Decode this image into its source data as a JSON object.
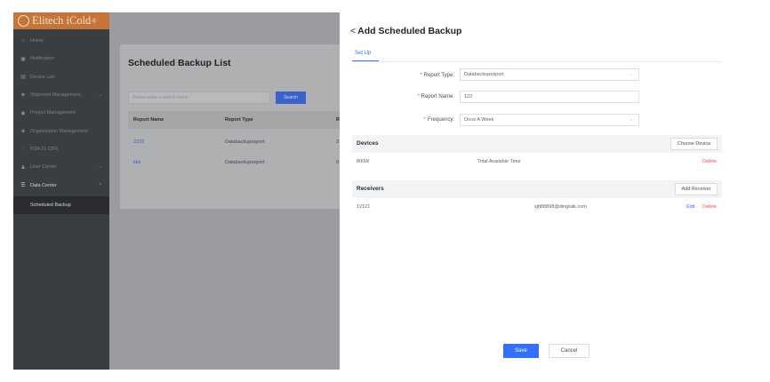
{
  "brand": {
    "name": "Elitech iCold",
    "mark": "®"
  },
  "sidebar": {
    "items": [
      {
        "label": "Home",
        "icon": "home-icon",
        "glyph": "⌂"
      },
      {
        "label": "Notification",
        "icon": "notification-icon",
        "glyph": "▣"
      },
      {
        "label": "Device List",
        "icon": "device-icon",
        "glyph": "▤"
      },
      {
        "label": "Shipment Management",
        "icon": "shipment-icon",
        "glyph": "⚑",
        "chevron": "⌄"
      },
      {
        "label": "Project Management",
        "icon": "project-icon",
        "glyph": "◉"
      },
      {
        "label": "Organization Management",
        "icon": "organization-icon",
        "glyph": "◈"
      },
      {
        "label": "FDA 21 CFR",
        "icon": "fda-icon",
        "glyph": "◌"
      },
      {
        "label": "User Center",
        "icon": "user-icon",
        "glyph": "♟",
        "chevron": "⌄"
      },
      {
        "label": "Data Center",
        "icon": "data-center-icon",
        "glyph": "☰",
        "chevron": "⌃"
      }
    ],
    "sub_item": "Scheduled Backup"
  },
  "list": {
    "title": "Scheduled Backup List",
    "search_placeholder": "Please enter a search name",
    "search_button": "Search",
    "columns": [
      "Report Name",
      "Report Type",
      "R"
    ],
    "rows": [
      {
        "name": "2222",
        "type": "Databackupexport",
        "extra": "3"
      },
      {
        "name": "kkk",
        "type": "Databackupexport",
        "extra": "0"
      }
    ]
  },
  "drawer": {
    "back": "<",
    "title": "Add Scheduled Backup",
    "tab": "Set Up",
    "form": {
      "report_type_label": "Report Type:",
      "report_type_value": "Databackupexport",
      "report_name_label": "Report Name:",
      "report_name_value": "122",
      "frequency_label": "Frequency:",
      "frequency_value": "Once A Week",
      "required_mark": "*",
      "dropdown_glyph": "⌄"
    },
    "devices": {
      "title": "Devices",
      "button": "Choose Device",
      "rows": [
        {
          "name": "800W",
          "detail": "Total Available Time",
          "delete": "Delete"
        }
      ]
    },
    "receivers": {
      "title": "Receivers",
      "button": "Add Receiver",
      "rows": [
        {
          "name": "12121",
          "email": "xjtt88898@dingtalk.com",
          "edit": "Edit",
          "delete": "Delete"
        }
      ]
    },
    "save": "Save",
    "cancel": "Cancel"
  },
  "colors": {
    "brand": "#c77438",
    "sidebar": "#3a3d42",
    "primary": "#3370ff",
    "danger": "#e84949"
  }
}
